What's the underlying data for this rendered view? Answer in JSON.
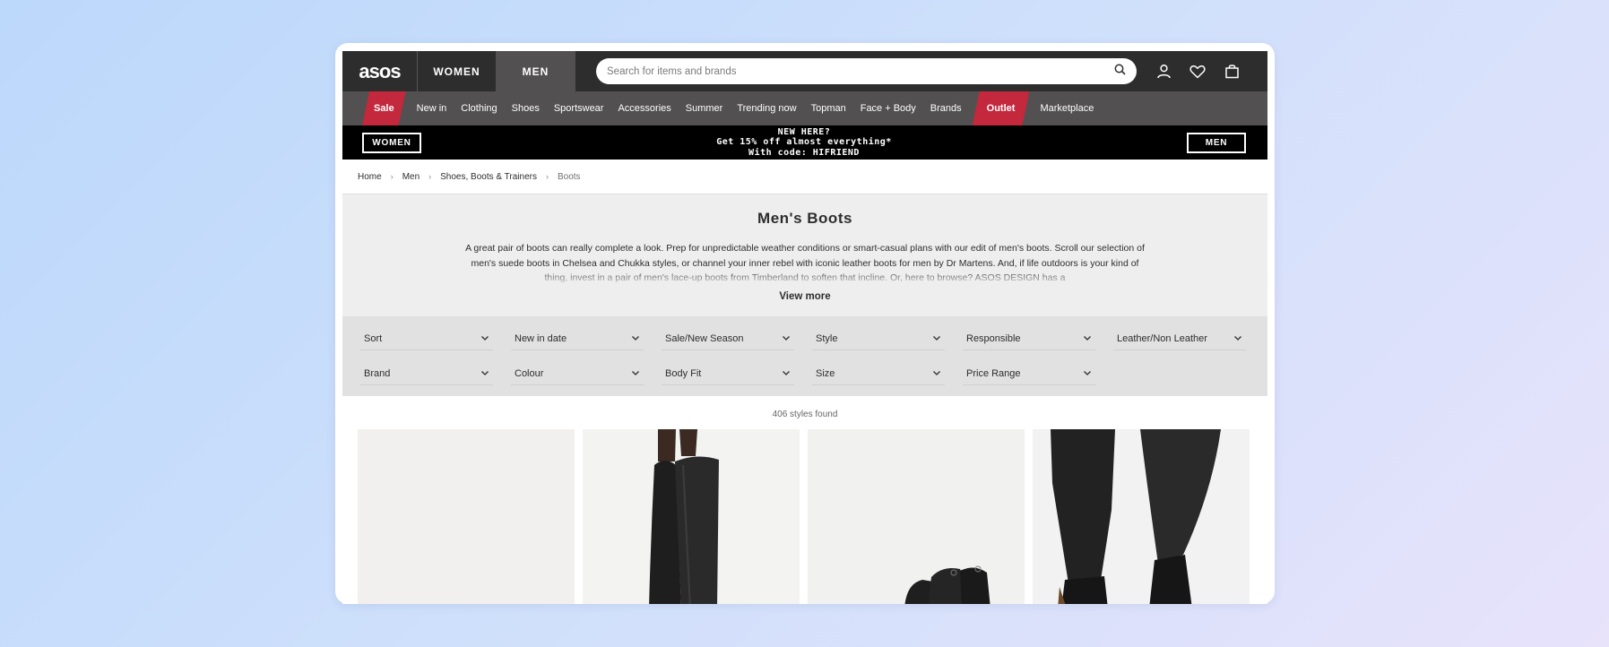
{
  "header": {
    "logo": "asos",
    "tabs": [
      {
        "label": "WOMEN"
      },
      {
        "label": "MEN"
      }
    ],
    "search_placeholder": "Search for items and brands",
    "icons": [
      "account-icon",
      "heart-icon",
      "bag-icon"
    ]
  },
  "nav": {
    "sale": "Sale",
    "items": [
      "New in",
      "Clothing",
      "Shoes",
      "Sportswear",
      "Accessories",
      "Summer",
      "Trending now",
      "Topman",
      "Face + Body",
      "Brands"
    ],
    "outlet": "Outlet",
    "marketplace": "Marketplace"
  },
  "promo": {
    "women": "WOMEN",
    "men": "MEN",
    "line1": "NEW HERE?",
    "line2": "Get 15% off almost everything*",
    "line3": "With code: HIFRIEND"
  },
  "breadcrumb": [
    "Home",
    "Men",
    "Shoes, Boots & Trainers",
    "Boots"
  ],
  "category": {
    "title": "Men's Boots",
    "description": "A great pair of boots can really complete a look. Prep for unpredictable weather conditions or smart-casual plans with our edit of men's boots. Scroll our selection of men's suede boots in Chelsea and Chukka styles, or channel your inner rebel with iconic leather boots for men by Dr Martens. And, if life outdoors is your kind of thing, invest in a pair of men's lace-up boots from Timberland to soften that incline. Or, here to browse? ASOS DESIGN has a",
    "view_more": "View more"
  },
  "filters": {
    "row1": [
      "Sort",
      "New in date",
      "Sale/New Season",
      "Style",
      "Responsible",
      "Leather/Non Leather"
    ],
    "row2": [
      "Brand",
      "Colour",
      "Body Fit",
      "Size",
      "Price Range"
    ]
  },
  "results": {
    "count": "406 styles found"
  },
  "colors": {
    "header_bg": "#2d2d2d",
    "nav_bg": "#525050",
    "sale_red": "#c3283d",
    "promo_bg": "#000000"
  }
}
